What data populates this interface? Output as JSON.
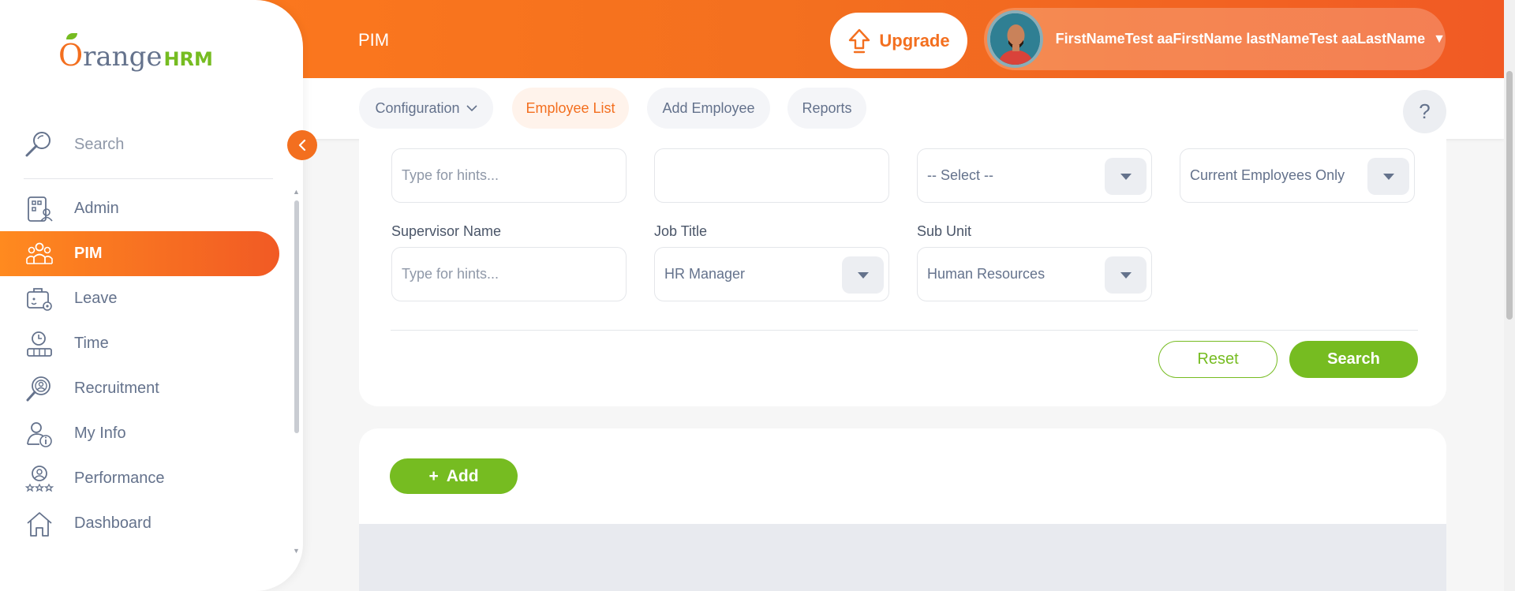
{
  "header": {
    "title": "PIM",
    "upgrade_label": "Upgrade",
    "user_name": "FirstNameTest aaFirstName lastNameTest aaLastName"
  },
  "subnav": {
    "tabs": [
      {
        "label": "Configuration",
        "active": false,
        "has_dropdown": true
      },
      {
        "label": "Employee List",
        "active": true
      },
      {
        "label": "Add Employee",
        "active": false
      },
      {
        "label": "Reports",
        "active": false
      }
    ],
    "help_label": "?"
  },
  "sidebar": {
    "logo": {
      "orange": "O",
      "range": "range",
      "hrm": "HRM"
    },
    "search_placeholder": "Search",
    "items": [
      {
        "label": "Admin",
        "icon": "admin-icon"
      },
      {
        "label": "PIM",
        "icon": "pim-icon",
        "active": true
      },
      {
        "label": "Leave",
        "icon": "leave-icon"
      },
      {
        "label": "Time",
        "icon": "time-icon"
      },
      {
        "label": "Recruitment",
        "icon": "recruitment-icon"
      },
      {
        "label": "My Info",
        "icon": "my-info-icon"
      },
      {
        "label": "Performance",
        "icon": "performance-icon"
      },
      {
        "label": "Dashboard",
        "icon": "dashboard-icon"
      }
    ]
  },
  "filters": {
    "row1": {
      "employee_name_placeholder": "Type for hints...",
      "employee_id_value": "",
      "employment_status_value": "-- Select --",
      "include_value": "Current Employees Only"
    },
    "row2": {
      "supervisor_label": "Supervisor Name",
      "supervisor_placeholder": "Type for hints...",
      "job_title_label": "Job Title",
      "job_title_value": "HR Manager",
      "sub_unit_label": "Sub Unit",
      "sub_unit_value": "Human Resources"
    },
    "reset_label": "Reset",
    "search_label": "Search"
  },
  "records": {
    "add_label": "Add",
    "add_prefix": "+"
  },
  "colors": {
    "brand_orange": "#f36f1f",
    "brand_green": "#76bc21",
    "text_gray": "#64728c"
  }
}
